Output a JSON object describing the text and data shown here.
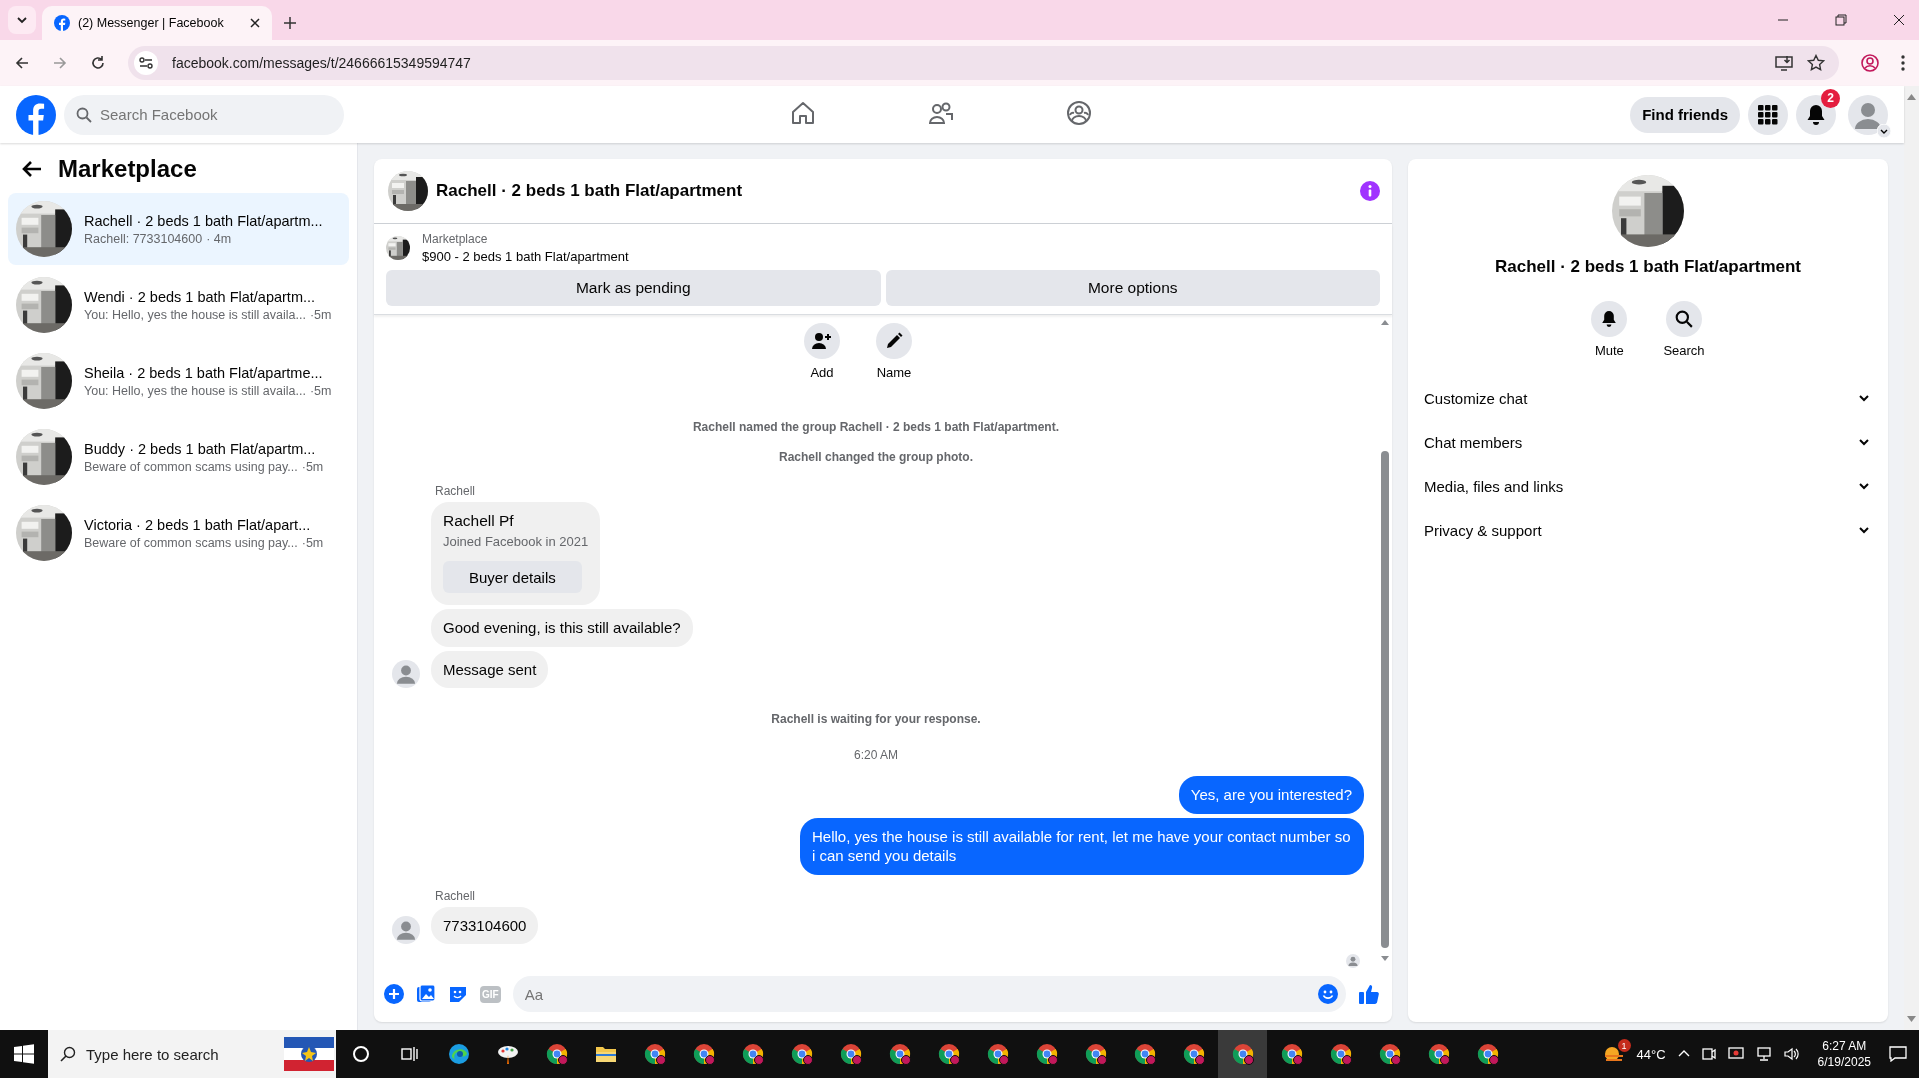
{
  "browser": {
    "tab": {
      "title": "(2) Messenger | Facebook",
      "selected": true
    },
    "url": "facebook.com/messages/t/24666615349594747"
  },
  "header": {
    "search_placeholder": "Search Facebook",
    "nav": [
      {
        "kind": "home",
        "selected": false
      },
      {
        "kind": "friends",
        "selected": false
      },
      {
        "kind": "groups",
        "selected": false
      }
    ],
    "find_friends": "Find friends",
    "notification_badge": "2"
  },
  "sidebar": {
    "title": "Marketplace",
    "conversations": [
      {
        "title": "Rachell · 2 beds 1 bath Flat/apartm...",
        "preview": "Rachell: 7733104600",
        "time": "· 4m",
        "selected": true
      },
      {
        "title": "Wendi · 2 beds 1 bath Flat/apartm...",
        "preview": "You: Hello, yes the house is still availa...",
        "time": "·5m",
        "selected": false
      },
      {
        "title": "Sheila · 2 beds 1 bath Flat/apartme...",
        "preview": "You: Hello, yes the house is still availa...",
        "time": "·5m",
        "selected": false
      },
      {
        "title": "Buddy · 2 beds 1 bath Flat/apartm...",
        "preview": "Beware of common scams using pay...",
        "time": "·5m",
        "selected": false
      },
      {
        "title": "Victoria · 2 beds 1 bath Flat/apart...",
        "preview": "Beware of common scams using pay...",
        "time": "·5m",
        "selected": false
      }
    ]
  },
  "chat": {
    "title": "Rachell · 2 beds 1 bath Flat/apartment",
    "listing": {
      "label": "Marketplace",
      "title": "$900 - 2 beds 1 bath Flat/apartment"
    },
    "buttons": [
      "Mark as pending",
      "More options"
    ],
    "actions": [
      {
        "kind": "add",
        "label": "Add"
      },
      {
        "kind": "edit",
        "label": "Name"
      }
    ],
    "messages": [
      {
        "kind": "system",
        "text": "Rachell named the group Rachell · 2 beds 1 bath Flat/apartment."
      },
      {
        "kind": "system",
        "text": "Rachell changed the group photo."
      },
      {
        "kind": "sender",
        "text": "Rachell"
      },
      {
        "kind": "card",
        "text": "Rachell Pf",
        "sub": "Joined Facebook in 2021",
        "button": "Buyer details"
      },
      {
        "kind": "incoming",
        "text": "Good evening, is this still available?",
        "avatar": false
      },
      {
        "kind": "incoming",
        "text": "Message sent",
        "avatar": true
      },
      {
        "kind": "system",
        "text": "Rachell is waiting for your response."
      },
      {
        "kind": "time",
        "text": "6:20 AM"
      },
      {
        "kind": "outgoing",
        "text": "Yes, are you interested?"
      },
      {
        "kind": "outgoing",
        "text": "Hello, yes the house is still available for rent, let me have your contact number so i can send you details"
      },
      {
        "kind": "sender",
        "text": "Rachell"
      },
      {
        "kind": "incoming",
        "text": "7733104600",
        "avatar": true
      }
    ],
    "composer": {
      "placeholder": "Aa",
      "gif": "GIF"
    }
  },
  "details": {
    "title": "Rachell · 2 beds 1 bath Flat/apartment",
    "actions": [
      {
        "kind": "mute",
        "label": "Mute"
      },
      {
        "kind": "search",
        "label": "Search"
      }
    ],
    "sections": [
      {
        "label": "Customize chat",
        "expanded": false
      },
      {
        "label": "Chat members",
        "expanded": false
      },
      {
        "label": "Media, files and links",
        "expanded": false
      },
      {
        "label": "Privacy & support",
        "expanded": false
      }
    ]
  },
  "taskbar": {
    "search_placeholder": "Type here to search",
    "apps": [
      {
        "kind": "cortana",
        "selected": false
      },
      {
        "kind": "taskview",
        "selected": false
      },
      {
        "kind": "edge",
        "selected": false
      },
      {
        "kind": "paint",
        "selected": false
      },
      {
        "kind": "chrome",
        "selected": false
      },
      {
        "kind": "folder",
        "selected": false
      },
      {
        "kind": "chrome",
        "selected": false
      },
      {
        "kind": "chrome",
        "selected": false
      },
      {
        "kind": "chrome",
        "selected": false
      },
      {
        "kind": "chrome",
        "selected": false
      },
      {
        "kind": "chrome",
        "selected": false
      },
      {
        "kind": "chrome",
        "selected": false
      },
      {
        "kind": "chrome",
        "selected": false
      },
      {
        "kind": "chrome",
        "selected": false
      },
      {
        "kind": "chrome",
        "selected": false
      },
      {
        "kind": "chrome",
        "selected": false
      },
      {
        "kind": "chrome",
        "selected": false
      },
      {
        "kind": "chrome",
        "selected": false
      },
      {
        "kind": "chrome",
        "selected": true
      },
      {
        "kind": "chrome",
        "selected": false
      },
      {
        "kind": "chrome",
        "selected": false
      },
      {
        "kind": "chrome",
        "selected": false
      },
      {
        "kind": "chrome",
        "selected": false
      },
      {
        "kind": "chrome",
        "selected": false
      }
    ],
    "weather_badge": "1",
    "temperature": "44°C",
    "time": "6:27 AM",
    "date": "6/19/2025"
  }
}
